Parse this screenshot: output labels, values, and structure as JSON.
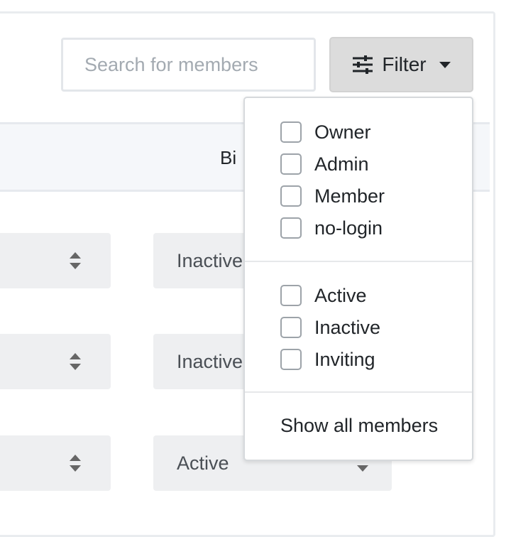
{
  "search": {
    "placeholder": "Search for members",
    "value": ""
  },
  "filter_button": {
    "label": "Filter",
    "icon": "sliders-icon"
  },
  "table": {
    "header_partial": "Bi",
    "rows": [
      {
        "status": "Inactive"
      },
      {
        "status": "Inactive"
      },
      {
        "status": "Active"
      }
    ]
  },
  "filter_menu": {
    "roles": [
      {
        "label": "Owner",
        "checked": false
      },
      {
        "label": "Admin",
        "checked": false
      },
      {
        "label": "Member",
        "checked": false
      },
      {
        "label": "no-login",
        "checked": false
      }
    ],
    "statuses": [
      {
        "label": "Active",
        "checked": false
      },
      {
        "label": "Inactive",
        "checked": false
      },
      {
        "label": "Inviting",
        "checked": false
      }
    ],
    "show_all_label": "Show all members"
  }
}
